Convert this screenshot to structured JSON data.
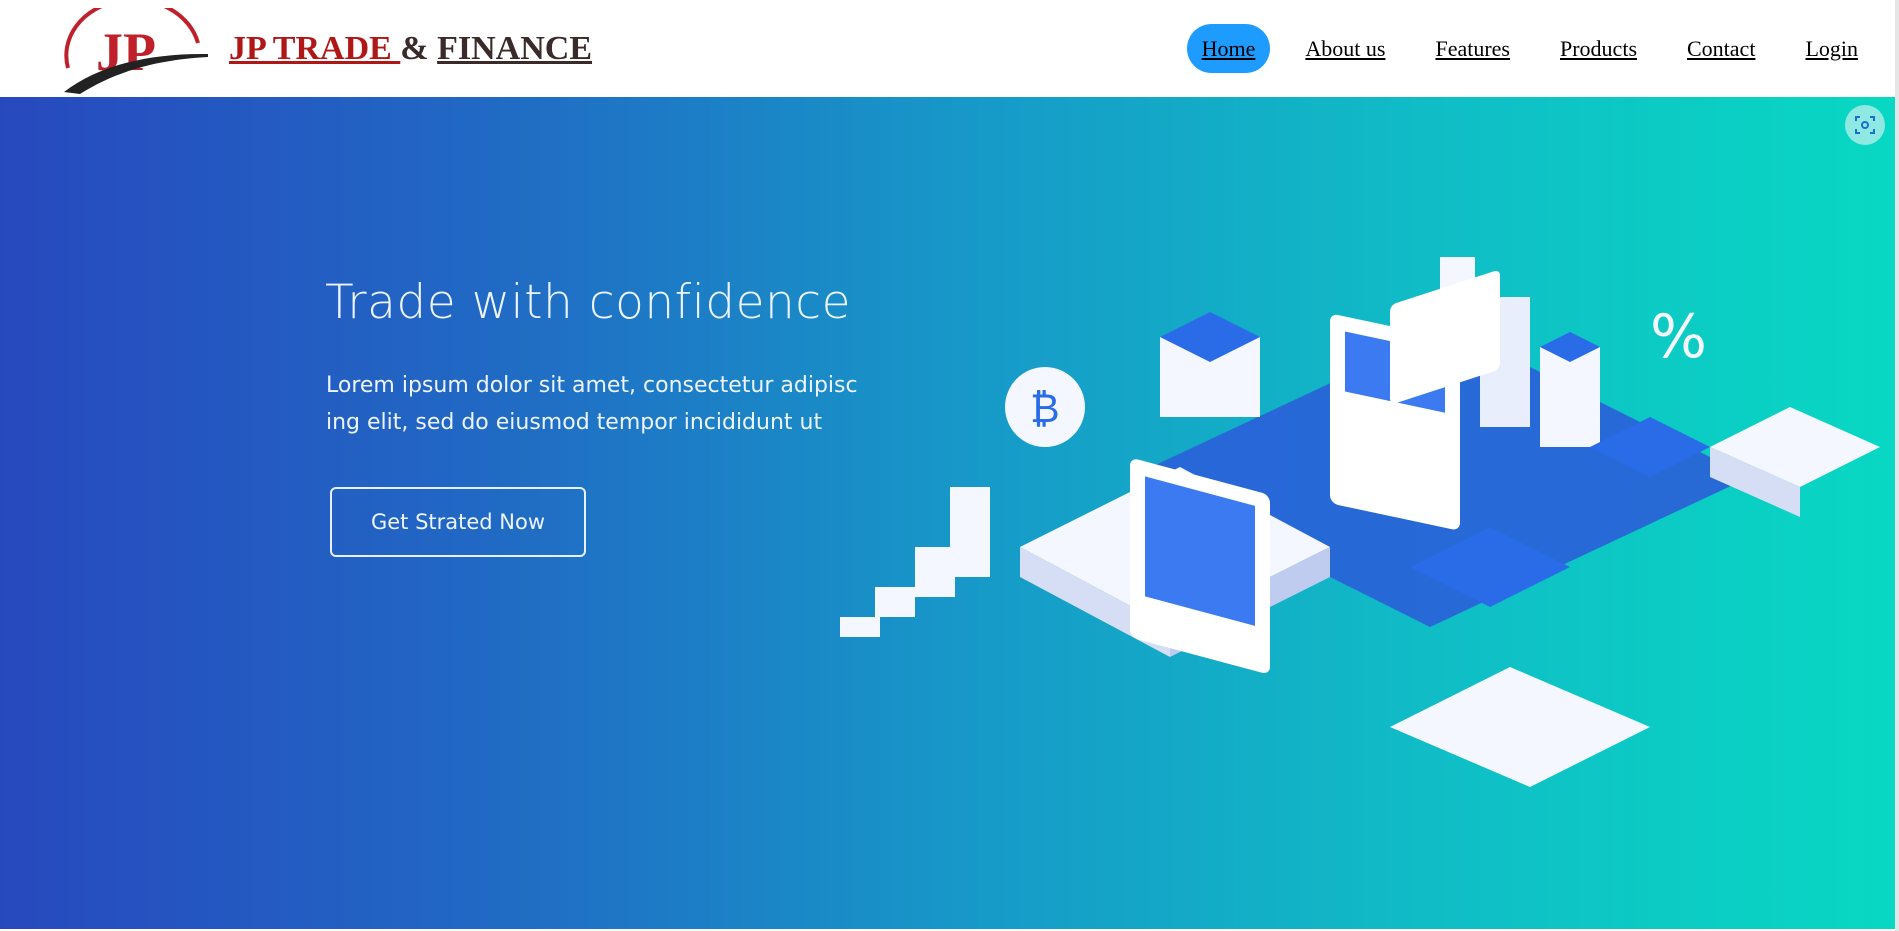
{
  "header": {
    "brand_part1": "JP TRADE ",
    "brand_amp": "& ",
    "brand_part2": "FINANCE",
    "logo_letters": "JP"
  },
  "nav": [
    {
      "label": "Home",
      "active": true
    },
    {
      "label": "About us"
    },
    {
      "label": "Features"
    },
    {
      "label": "Products"
    },
    {
      "label": "Contact"
    },
    {
      "label": "Login"
    }
  ],
  "hero": {
    "title": "Trade with confidence",
    "body": "Lorem ipsum dolor sit amet, consectetur adipisc ing elit, sed do eiusmod tempor incididunt ut",
    "cta": "Get Strated Now"
  },
  "colors": {
    "nav_active": "#1e9bff",
    "brand_red": "#b01818",
    "gradient_start": "#2749be",
    "gradient_end": "#08d8c3"
  }
}
